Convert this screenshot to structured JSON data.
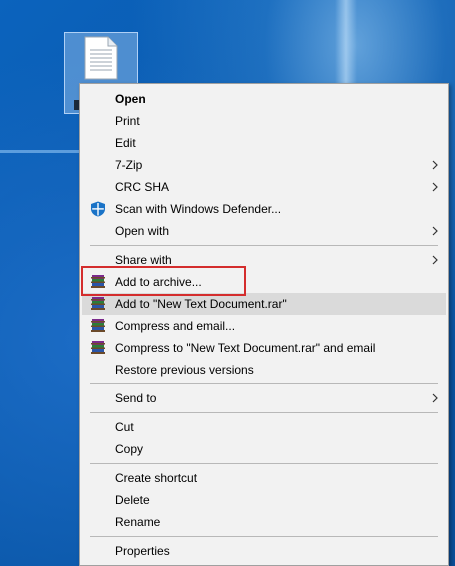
{
  "menu": {
    "items": [
      {
        "label": "Open"
      },
      {
        "label": "Print"
      },
      {
        "label": "Edit"
      },
      {
        "label": "7-Zip"
      },
      {
        "label": "CRC SHA"
      },
      {
        "label": "Scan with Windows Defender..."
      },
      {
        "label": "Open with"
      },
      {
        "label": "Share with"
      },
      {
        "label": "Add to archive..."
      },
      {
        "label": "Add to \"New Text Document.rar\""
      },
      {
        "label": "Compress and email..."
      },
      {
        "label": "Compress to \"New Text Document.rar\" and email"
      },
      {
        "label": "Restore previous versions"
      },
      {
        "label": "Send to"
      },
      {
        "label": "Cut"
      },
      {
        "label": "Copy"
      },
      {
        "label": "Create shortcut"
      },
      {
        "label": "Delete"
      },
      {
        "label": "Rename"
      },
      {
        "label": "Properties"
      }
    ]
  },
  "colors": {
    "highlight_border": "#d42d2d",
    "hover_row": "#dadada",
    "menu_bg": "#f2f2f2"
  },
  "icons": {
    "desktop_file": "text-document-icon",
    "winrar": "winrar-icon",
    "defender": "windows-defender-icon",
    "submenu": "chevron-right-icon"
  }
}
